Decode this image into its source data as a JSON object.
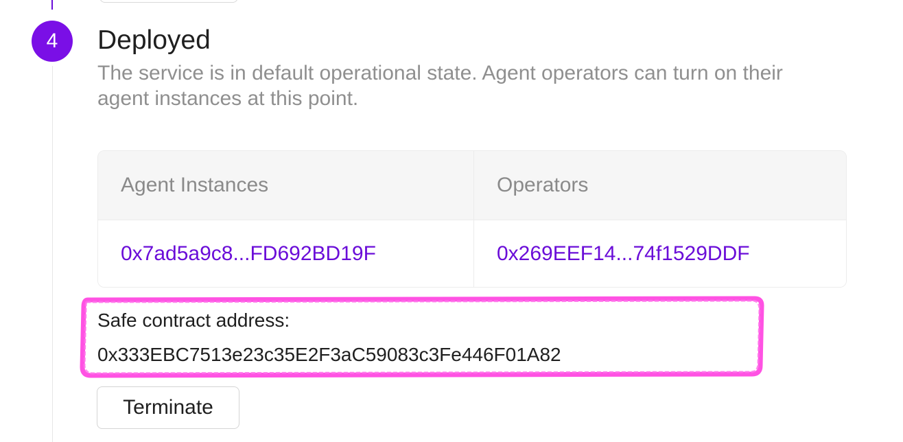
{
  "step": {
    "number": "4",
    "title": "Deployed",
    "description": "The service is in default operational state. Agent operators can turn on their agent instances at this point."
  },
  "table": {
    "headers": [
      "Agent Instances",
      "Operators"
    ],
    "rows": [
      {
        "agent_instance": "0x7ad5a9c8...FD692BD19F",
        "operator": "0x269EEF14...74f1529DDF"
      }
    ]
  },
  "safe_contract": {
    "label": "Safe contract address:",
    "address": "0x333EBC7513e23c35E2F3aC59083c3Fe446F01A82"
  },
  "actions": {
    "terminate_label": "Terminate"
  },
  "colors": {
    "accent": "#7a0fe6",
    "link": "#6a0dd8",
    "highlight": "#ff3fe0"
  }
}
